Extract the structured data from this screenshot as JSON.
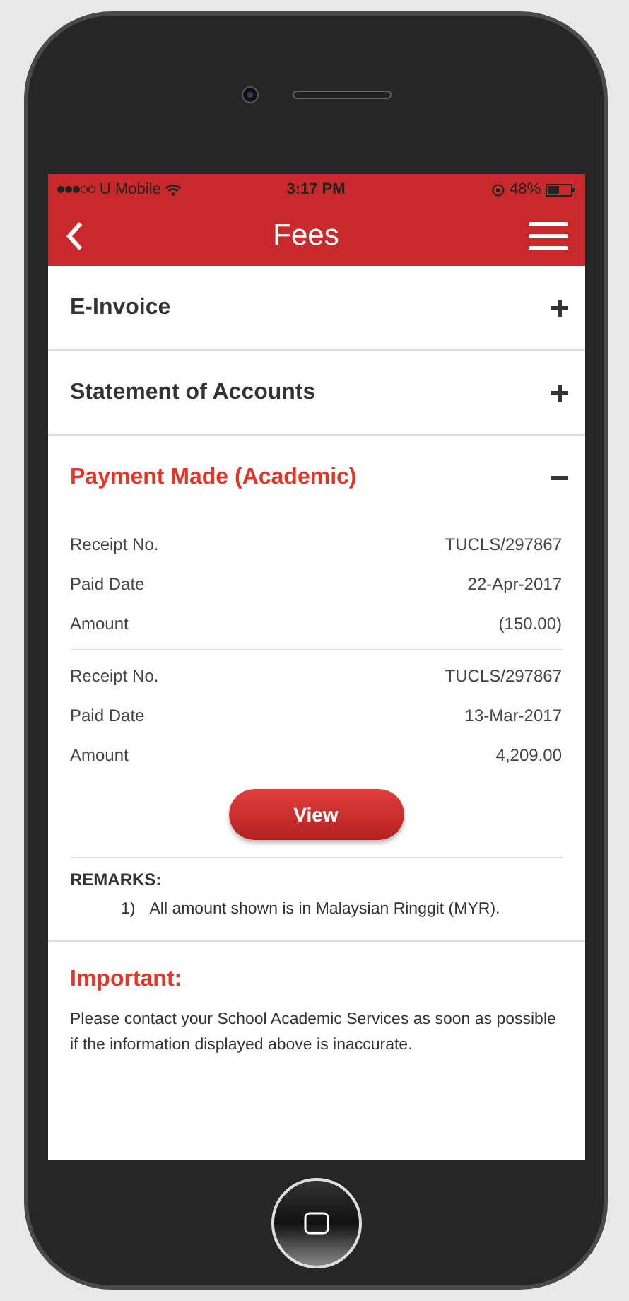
{
  "status_bar": {
    "carrier": "U Mobile",
    "time": "3:17 PM",
    "battery": "48%"
  },
  "nav_bar": {
    "title": "Fees"
  },
  "sections": [
    {
      "title": "E-Invoice",
      "expanded": false
    },
    {
      "title": "Statement of Accounts",
      "expanded": false
    },
    {
      "title": "Payment Made (Academic)",
      "expanded": true,
      "payments": [
        {
          "fields": [
            {
              "label": "Receipt No.",
              "value": "TUCLS/297867"
            },
            {
              "label": "Paid Date",
              "value": "22-Apr-2017"
            },
            {
              "label": "Amount",
              "value": "(150.00)"
            }
          ]
        },
        {
          "fields": [
            {
              "label": "Receipt No.",
              "value": "TUCLS/297867"
            },
            {
              "label": "Paid Date",
              "value": "13-Mar-2017"
            },
            {
              "label": "Amount",
              "value": "4,209.00"
            }
          ]
        }
      ],
      "button": "View",
      "remarks_title": "REMARKS:",
      "remarks": [
        {
          "number": "1)",
          "text": "All amount shown is in Malaysian Ringgit (MYR)."
        }
      ]
    }
  ],
  "important": {
    "title": "Important:",
    "text": "Please contact your School Academic Services as soon as possible if the information displayed above is inaccurate."
  }
}
